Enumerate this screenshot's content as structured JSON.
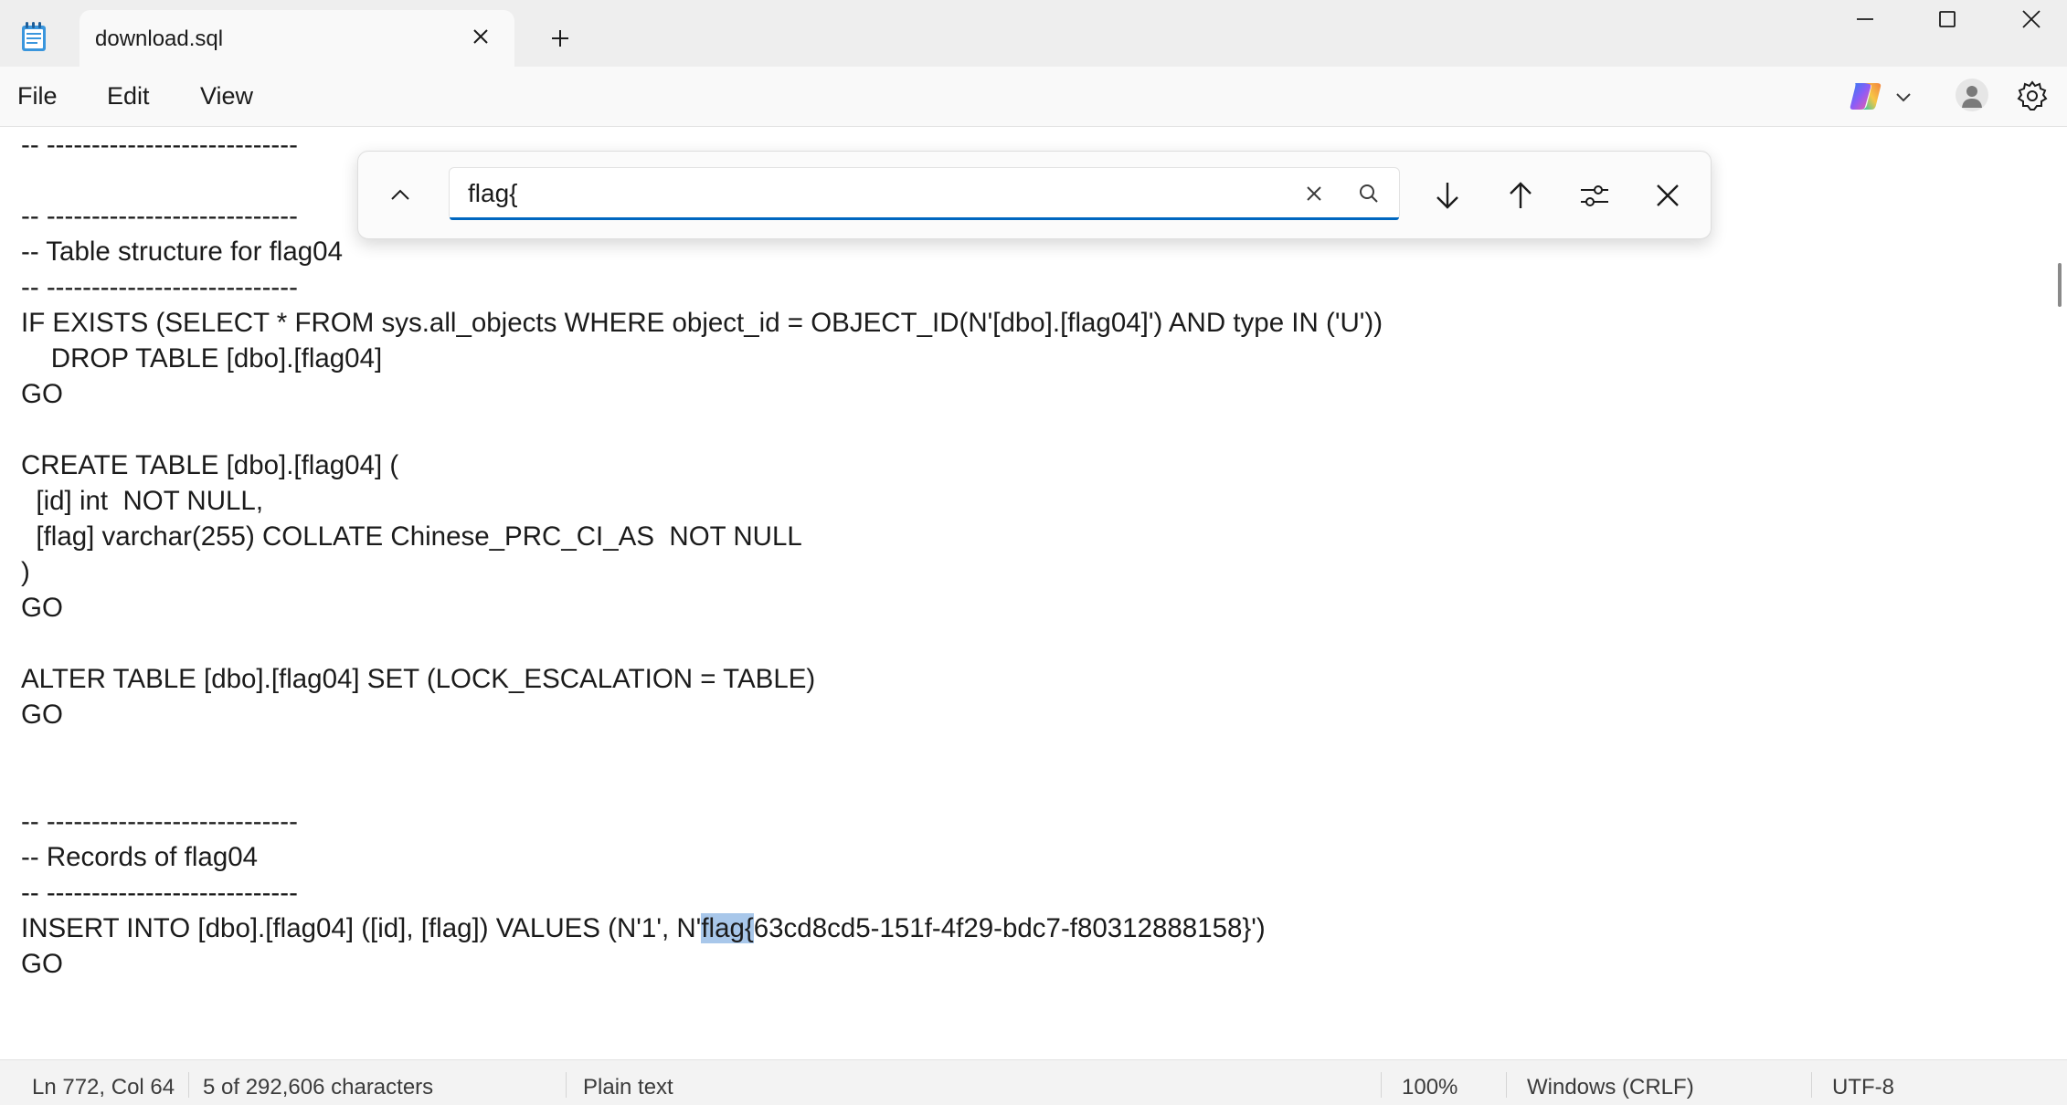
{
  "tab": {
    "title": "download.sql"
  },
  "menu": {
    "file": "File",
    "edit": "Edit",
    "view": "View"
  },
  "find": {
    "query": "flag{"
  },
  "editor": {
    "lines": [
      "-- ----------------------------",
      "",
      "-- ----------------------------",
      "-- Table structure for flag04",
      "-- ----------------------------",
      "IF EXISTS (SELECT * FROM sys.all_objects WHERE object_id = OBJECT_ID(N'[dbo].[flag04]') AND type IN ('U'))",
      "\tDROP TABLE [dbo].[flag04]",
      "GO",
      "",
      "CREATE TABLE [dbo].[flag04] (",
      "  [id] int  NOT NULL,",
      "  [flag] varchar(255) COLLATE Chinese_PRC_CI_AS  NOT NULL",
      ")",
      "GO",
      "",
      "ALTER TABLE [dbo].[flag04] SET (LOCK_ESCALATION = TABLE)",
      "GO",
      "",
      "",
      "-- ----------------------------",
      "-- Records of flag04",
      "-- ----------------------------",
      "GO"
    ],
    "insert_prefix": "INSERT INTO [dbo].[flag04] ([id], [flag]) VALUES (N'1', N'",
    "insert_match": "flag{",
    "insert_suffix": "63cd8cd5-151f-4f29-bdc7-f80312888158}')"
  },
  "status": {
    "position": "Ln 772, Col 64",
    "selection": "5 of 292,606 characters",
    "language": "Plain text",
    "zoom": "100%",
    "line_ending": "Windows (CRLF)",
    "encoding": "UTF-8"
  }
}
